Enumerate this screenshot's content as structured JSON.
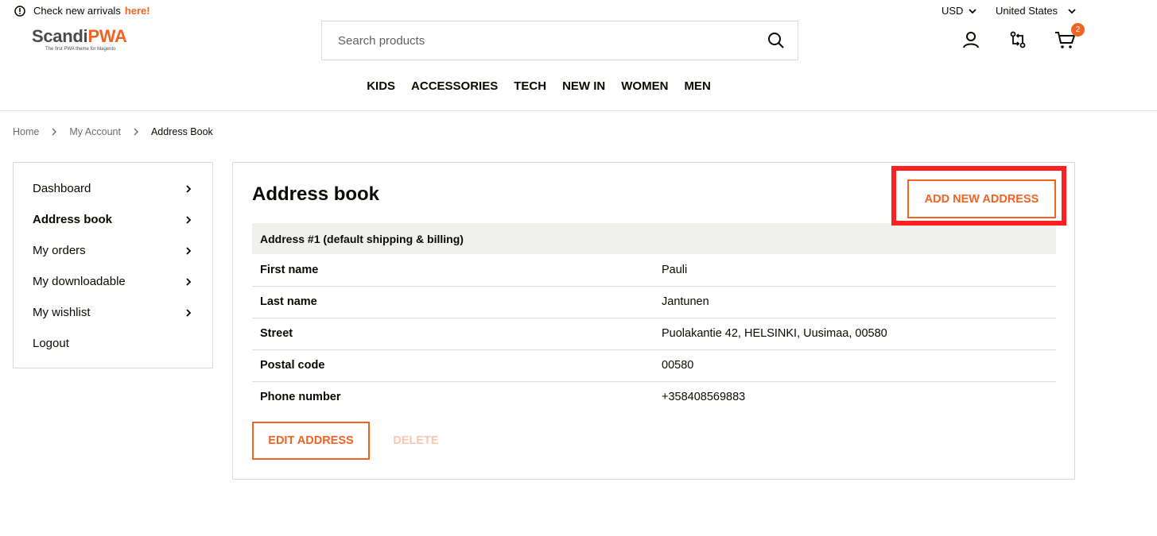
{
  "notice": {
    "text": "Check new arrivals",
    "link": "here!"
  },
  "currency": {
    "value": "USD"
  },
  "country": {
    "value": "United States"
  },
  "logo": {
    "brand_main": "Scandi",
    "brand_accent": "PWA",
    "tagline": "The first PWA theme for Magento"
  },
  "search": {
    "placeholder": "Search products",
    "value": ""
  },
  "cart": {
    "count": "2"
  },
  "menu": {
    "items": [
      "KIDS",
      "ACCESSORIES",
      "TECH",
      "NEW IN",
      "WOMEN",
      "MEN"
    ]
  },
  "breadcrumbs": [
    "Home",
    "My Account",
    "Address Book"
  ],
  "sidebar": {
    "items": [
      {
        "label": "Dashboard"
      },
      {
        "label": "Address book"
      },
      {
        "label": "My orders"
      },
      {
        "label": "My downloadable"
      },
      {
        "label": "My wishlist"
      },
      {
        "label": "Logout"
      }
    ]
  },
  "content": {
    "title": "Address book",
    "add_button": "ADD NEW ADDRESS",
    "address_header": "Address #1 (default shipping & billing)",
    "rows": [
      {
        "key": "First name",
        "value": "Pauli"
      },
      {
        "key": "Last name",
        "value": "Jantunen"
      },
      {
        "key": "Street",
        "value": "Puolakantie 42, HELSINKI, Uusimaa, 00580"
      },
      {
        "key": "Postal code",
        "value": "00580"
      },
      {
        "key": "Phone number",
        "value": "+358408569883"
      }
    ],
    "edit_button": "EDIT ADDRESS",
    "delete_button": "DELETE"
  },
  "colors": {
    "accent": "#f26323",
    "highlight": "#ff1f1f",
    "text": "#0a0903"
  }
}
